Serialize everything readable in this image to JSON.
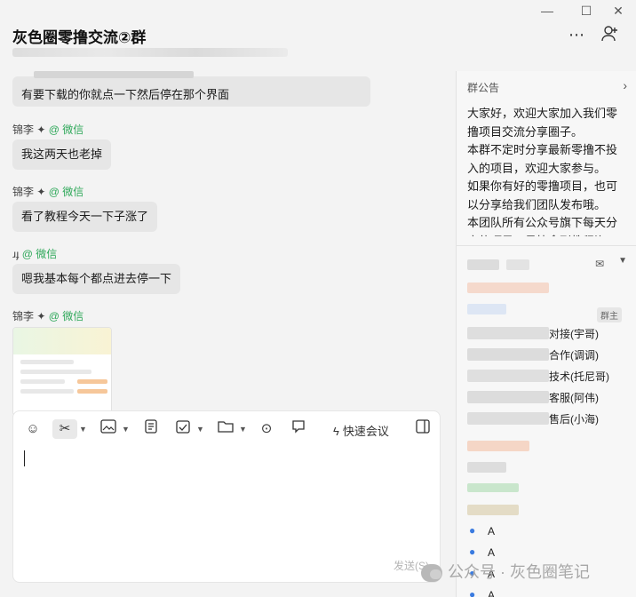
{
  "header": {
    "title": "灰色圈零撸交流②群"
  },
  "chat": {
    "messages": [
      {
        "text": "有要下载的你就点一下然后停在那个界面"
      },
      {
        "sender": "锦李",
        "sender_tag": "@ 微信",
        "text": "我这两天也老掉"
      },
      {
        "sender": "锦李",
        "sender_tag": "@ 微信",
        "text": "看了教程今天一下子涨了"
      },
      {
        "sender": "ɹɟ",
        "sender_tag": "@ 微信",
        "text": "嗯我基本每个都点进去停一下"
      },
      {
        "sender": "锦李",
        "sender_tag": "@ 微信"
      }
    ]
  },
  "editor": {
    "quick_meeting_label": "快速会议",
    "send_label": "发送(S)"
  },
  "right_panel": {
    "notice_title": "群公告",
    "notice_body": "大家好，欢迎大家加入我们零撸项目交流分享圈子。\n本群不定时分享最新零撸不投入的项目，欢迎大家参与。\n如果你有好的零撸项目，也可以分享给我们团队发布哦。\n本团队所有公众号旗下每天分享的项目可最快拿到教程资",
    "owner_badge": "群主",
    "member_roles": [
      "对接(宇哥)",
      "合作(调调)",
      "技术(托尼哥)",
      "客服(阿伟)",
      "售后(小海)"
    ],
    "member_names": [
      "A",
      "A",
      "A",
      "A"
    ]
  },
  "watermark": {
    "text": "公众号 · 灰色圈笔记"
  },
  "colors": {
    "accent_green": "#2fa85a",
    "background": "#f3f3f3",
    "bubble": "#e6e6e6",
    "person_icon_blue": "#3a7be0"
  }
}
